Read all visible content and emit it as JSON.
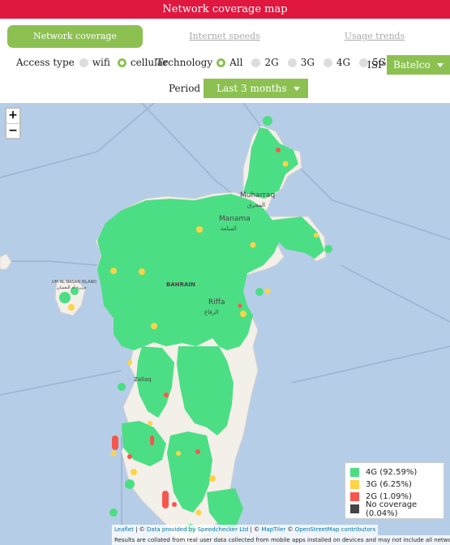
{
  "header": {
    "title": "Network coverage map"
  },
  "tabs": [
    {
      "label": "Network coverage"
    },
    {
      "label": "Internet speeds"
    },
    {
      "label": "Usage trends"
    }
  ],
  "filters": {
    "access_type": {
      "label": "Access type",
      "options": [
        "wifi",
        "cellular"
      ],
      "selected": "cellular"
    },
    "technology": {
      "label": "Technology",
      "options": [
        "All",
        "2G",
        "3G",
        "4G",
        "5G"
      ],
      "selected": "All"
    },
    "isp": {
      "label": "ISP",
      "value": "Batelco"
    },
    "period": {
      "label": "Period",
      "value": "Last 3 months"
    }
  },
  "map": {
    "zoom_in": "+",
    "zoom_out": "−",
    "places": {
      "muharraq_en": "Muharraq",
      "muharraq_ar": "المحرق",
      "manama_en": "Manama",
      "manama_ar": "المنامة",
      "bahrain": "BAHRAIN",
      "riffa_en": "Riffa",
      "riffa_ar": "الرفاع",
      "zallaq": "Zallaq",
      "hawar_en": "UM AL NASAN ISLAND",
      "hawar_ar": "جزيرة أم النعسان"
    },
    "colors": {
      "land": "#f3efe9",
      "water": "#b6cde8"
    }
  },
  "legend": [
    {
      "label": "4G (92.59%)",
      "color": "#4cde84"
    },
    {
      "label": "3G (6.25%)",
      "color": "#ffd346"
    },
    {
      "label": "2G (1.09%)",
      "color": "#f5574d"
    },
    {
      "label": "No coverage (0.04%)",
      "color": "#444444"
    }
  ],
  "attribution": {
    "leaflet": "Leaflet",
    "sep1": " | © ",
    "data": "Data provided by Speedchecker Ltd",
    "sep2": " | © ",
    "maptiler": "MapTiler",
    "sep3": " © ",
    "osm": "OpenStreetMap contributors",
    "footnote": "Results are collated from real user data collected from mobile apps installed on devices and may not include all networks."
  }
}
